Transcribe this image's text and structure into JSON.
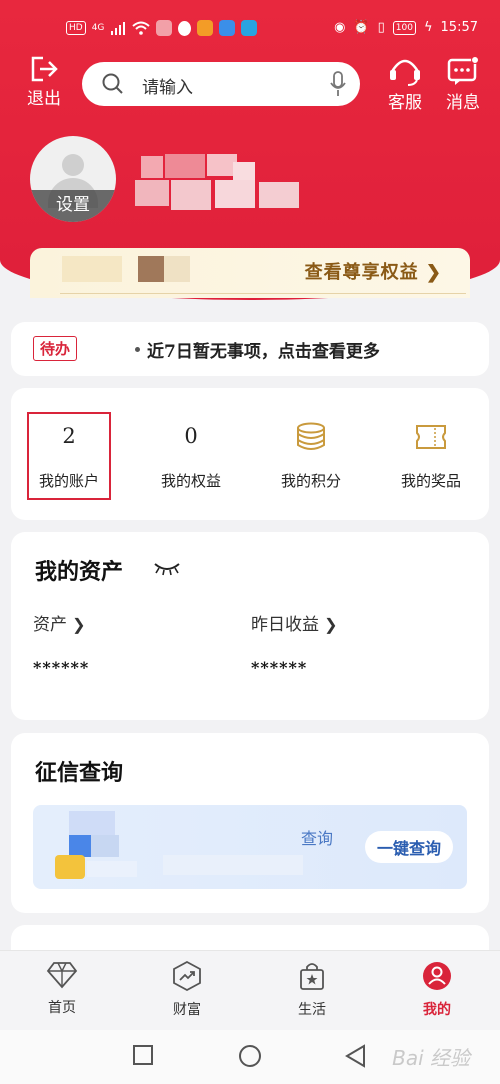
{
  "status_bar": {
    "left_badges": [
      "HD",
      "4G"
    ],
    "right_badges": [
      "100"
    ],
    "time": "15:57"
  },
  "header": {
    "exit_label": "退出",
    "search_placeholder": "请输入",
    "service_label": "客服",
    "message_label": "消息"
  },
  "profile": {
    "settings_label": "设置",
    "vip_link": "查看尊享权益"
  },
  "todo": {
    "tag": "待办",
    "text": "近7日暂无事项，点击查看更多"
  },
  "quick_links": [
    {
      "value": "2",
      "label": "我的账户"
    },
    {
      "value": "0",
      "label": "我的权益"
    },
    {
      "icon": "coins-icon",
      "label": "我的积分"
    },
    {
      "icon": "ticket-icon",
      "label": "我的奖品"
    }
  ],
  "assets": {
    "title": "我的资产",
    "asset_label": "资产",
    "asset_value": "******",
    "yesterday_label": "昨日收益",
    "yesterday_value": "******"
  },
  "credit": {
    "title": "征信查询",
    "banner_text": "查询",
    "button": "一键查询"
  },
  "tabs": [
    {
      "label": "首页",
      "icon": "diamond-icon"
    },
    {
      "label": "财富",
      "icon": "wealth-chart-icon"
    },
    {
      "label": "生活",
      "icon": "shopping-bag-icon"
    },
    {
      "label": "我的",
      "icon": "user-icon"
    }
  ],
  "active_tab": "我的",
  "colors": {
    "brand_red": "#e8283e",
    "gold": "#8a5a16",
    "link_blue": "#2a5db0"
  },
  "watermark": "Bai 经验"
}
